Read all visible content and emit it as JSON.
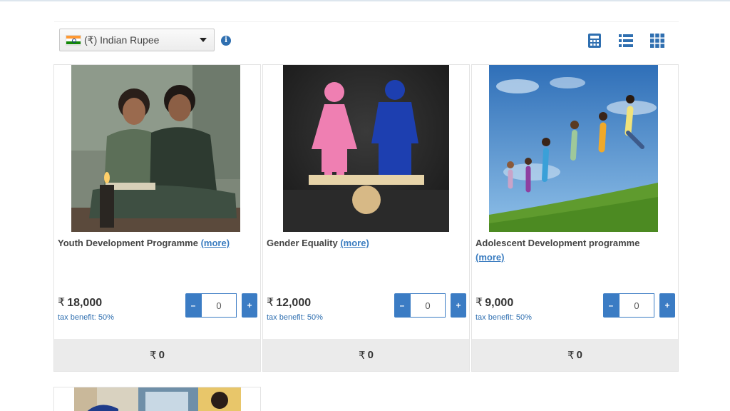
{
  "toolbar": {
    "currency": {
      "label": "(₹) Indian Rupee",
      "flag": "india-flag"
    },
    "info_icon": "i",
    "view_icons": [
      "calculator-icon",
      "list-view-icon",
      "grid-view-icon"
    ],
    "accent_color": "#2f6fb0"
  },
  "currency_symbol": "₹",
  "cards": [
    {
      "title": "Youth Development Programme",
      "more": "(more)",
      "price": "18,000",
      "tax": "tax benefit: 50%",
      "qty": "0",
      "total": "0",
      "minus": "–",
      "plus": "+"
    },
    {
      "title": "Gender Equality",
      "more": "(more)",
      "price": "12,000",
      "tax": "tax benefit: 50%",
      "qty": "0",
      "total": "0",
      "minus": "–",
      "plus": "+"
    },
    {
      "title": "Adolescent Development programme",
      "more": "(more)",
      "price": "9,000",
      "tax": "tax benefit: 50%",
      "qty": "0",
      "total": "0",
      "minus": "–",
      "plus": "+"
    }
  ]
}
